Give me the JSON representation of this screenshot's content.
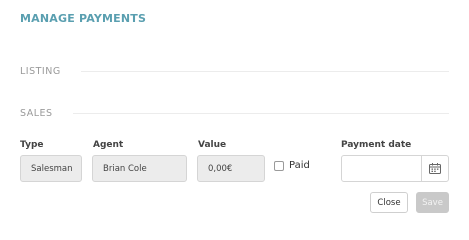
{
  "title": "MANAGE PAYMENTS",
  "sections": {
    "listing": "LISTING",
    "sales": "SALES"
  },
  "fields": {
    "type": {
      "label": "Type",
      "value": "Salesman"
    },
    "agent": {
      "label": "Agent",
      "value": "Brian Cole"
    },
    "value": {
      "label": "Value",
      "value": "0,00€"
    },
    "paid": {
      "label": "Paid",
      "checked": false
    },
    "payment_date": {
      "label": "Payment date",
      "value": ""
    }
  },
  "buttons": {
    "close": "Close",
    "save": "Save"
  },
  "icons": {
    "calendar": "calendar-icon"
  },
  "colors": {
    "title": "#5a9fb0",
    "save_disabled": "#c9c9c9"
  }
}
